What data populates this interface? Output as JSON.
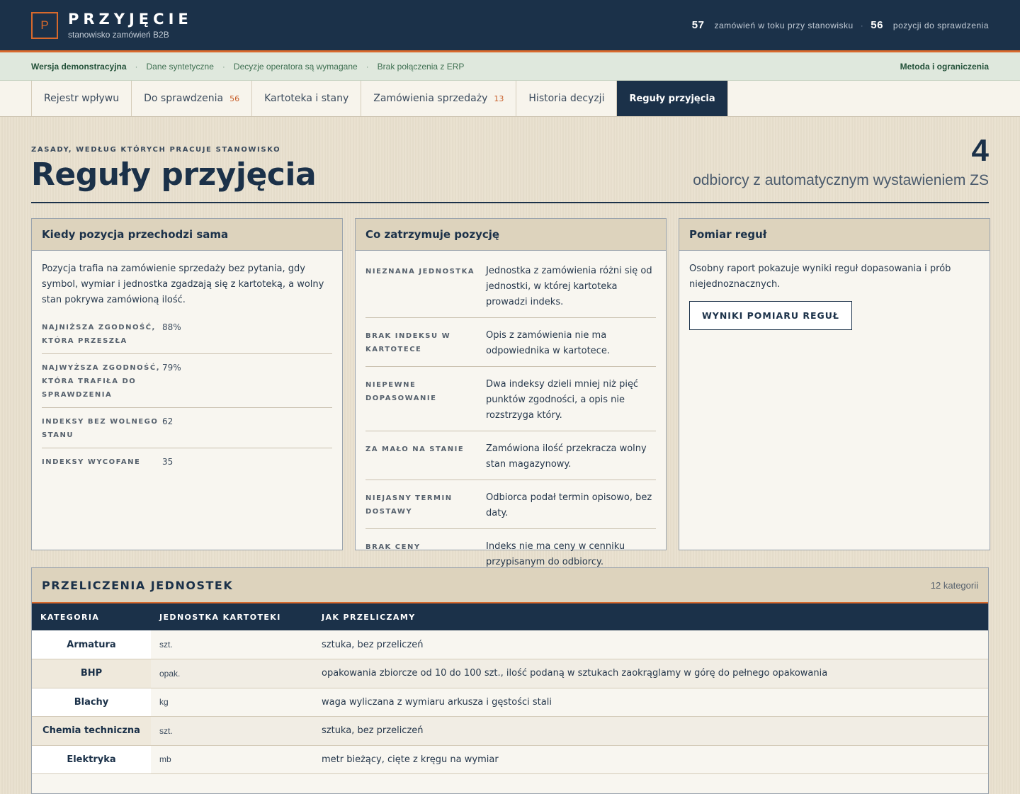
{
  "header": {
    "logo_letter": "P",
    "title": "PRZYJĘCIE",
    "subtitle": "stanowisko zamówień B2B",
    "stats": [
      {
        "value": "57",
        "label": "zamówień w toku przy stanowisku"
      },
      {
        "value": "56",
        "label": "pozycji do sprawdzenia"
      }
    ]
  },
  "notice": {
    "items": [
      "Wersja demonstracyjna",
      "Dane syntetyczne",
      "Decyzje operatora są wymagane",
      "Brak połączenia z ERP"
    ],
    "link": "Metoda i ograniczenia"
  },
  "tabs": [
    {
      "label": "Rejestr wpływu",
      "count": ""
    },
    {
      "label": "Do sprawdzenia",
      "count": "56"
    },
    {
      "label": "Kartoteka i stany",
      "count": ""
    },
    {
      "label": "Zamówienia sprzedaży",
      "count": "13"
    },
    {
      "label": "Historia decyzji",
      "count": ""
    },
    {
      "label": "Reguły przyjęcia",
      "count": ""
    }
  ],
  "page": {
    "eyebrow": "ZASADY, WEDŁUG KTÓRYCH PRACUJE STANOWISKO",
    "title": "Reguły przyjęcia",
    "kpi_value": "4",
    "kpi_label": "odbiorcy z automatycznym wystawieniem ZS"
  },
  "card_auto": {
    "title": "Kiedy pozycja przechodzi sama",
    "text": "Pozycja trafia na zamówienie sprzedaży bez pytania, gdy symbol, wymiar i jednostka zgadzają się z kartoteką, a wolny stan pokrywa zamówioną ilość.",
    "stats": [
      {
        "label": "NAJNIŻSZA ZGODNOŚĆ, KTÓRA PRZESZŁA",
        "value": "88%"
      },
      {
        "label": "NAJWYŻSZA ZGODNOŚĆ, KTÓRA TRAFIŁA DO SPRAWDZENIA",
        "value": "79%"
      },
      {
        "label": "INDEKSY BEZ WOLNEGO STANU",
        "value": "62"
      },
      {
        "label": "INDEKSY WYCOFANE",
        "value": "35"
      }
    ]
  },
  "card_hold": {
    "title": "Co zatrzymuje pozycję",
    "rows": [
      {
        "label": "NIEZNANA JEDNOSTKA",
        "desc": "Jednostka z zamówienia różni się od jednostki, w której kartoteka prowadzi indeks."
      },
      {
        "label": "BRAK INDEKSU W KARTOTECE",
        "desc": "Opis z zamówienia nie ma odpowiednika w kartotece."
      },
      {
        "label": "NIEPEWNE DOPASOWANIE",
        "desc": "Dwa indeksy dzieli mniej niż pięć punktów zgodności, a opis nie rozstrzyga który."
      },
      {
        "label": "ZA MAŁO NA STANIE",
        "desc": "Zamówiona ilość przekracza wolny stan magazynowy."
      },
      {
        "label": "NIEJASNY TERMIN DOSTAWY",
        "desc": "Odbiorca podał termin opisowo, bez daty."
      },
      {
        "label": "BRAK CENY",
        "desc": "Indeks nie ma ceny w cenniku przypisanym do odbiorcy."
      }
    ]
  },
  "card_measure": {
    "title": "Pomiar reguł",
    "text": "Osobny raport pokazuje wyniki reguł dopasowania i prób niejednoznacznych.",
    "button": "WYNIKI POMIARU REGUŁ"
  },
  "units": {
    "title": "PRZELICZENIA JEDNOSTEK",
    "count": "12 kategorii",
    "columns": [
      "KATEGORIA",
      "JEDNOSTKA KARTOTEKI",
      "JAK PRZELICZAMY"
    ],
    "rows": [
      {
        "category": "Armatura",
        "unit": "szt.",
        "how": "sztuka, bez przeliczeń"
      },
      {
        "category": "BHP",
        "unit": "opak.",
        "how": "opakowania zbiorcze od 10 do 100 szt., ilość podaną w sztukach zaokrąglamy w górę do pełnego opakowania"
      },
      {
        "category": "Blachy",
        "unit": "kg",
        "how": "waga wyliczana z wymiaru arkusza i gęstości stali"
      },
      {
        "category": "Chemia techniczna",
        "unit": "szt.",
        "how": "sztuka, bez przeliczeń"
      },
      {
        "category": "Elektryka",
        "unit": "mb",
        "how": "metr bieżący, cięte z kręgu na wymiar"
      }
    ]
  },
  "colors": {
    "navy": "#1b3149",
    "accent": "#d8692c",
    "notice_green": "#3f7052"
  }
}
